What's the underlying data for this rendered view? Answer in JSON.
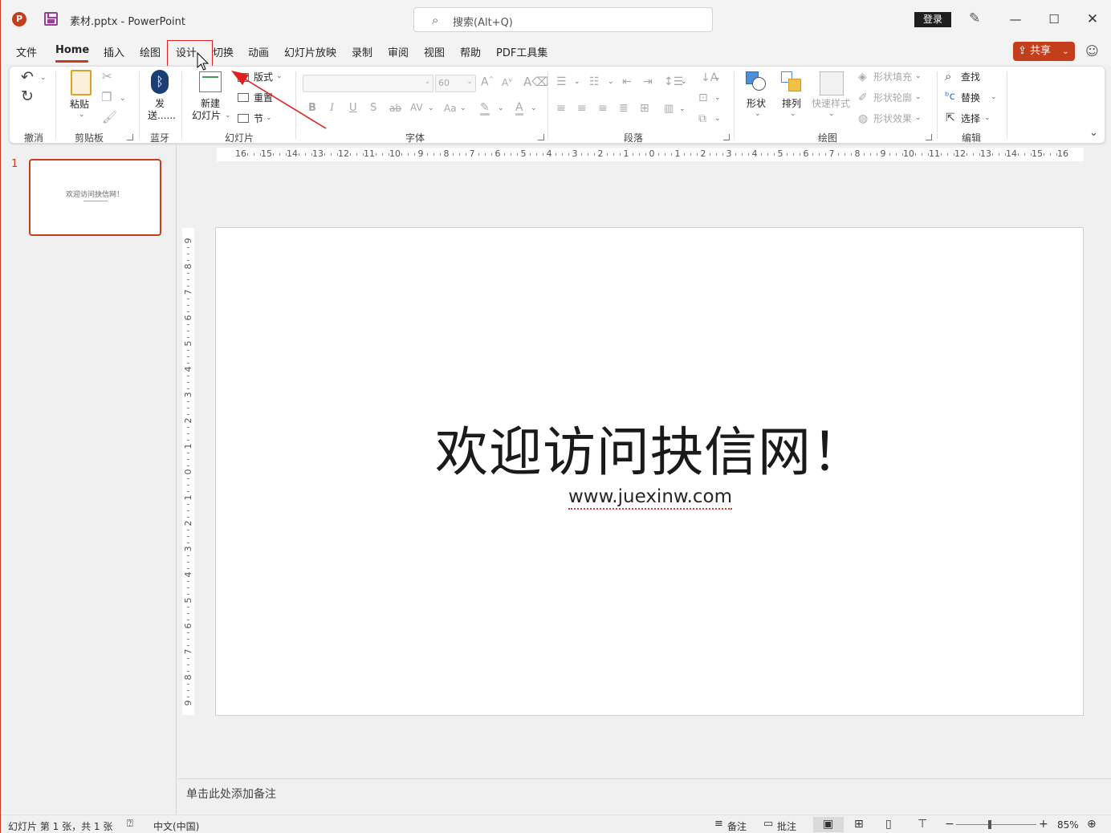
{
  "window": {
    "app_logo": "P",
    "title": "素材.pptx  -  PowerPoint",
    "search_placeholder": "搜索(Alt+Q)",
    "login_label": "登录",
    "minimize": "—",
    "maximize": "☐",
    "close": "✕"
  },
  "tabs": [
    {
      "label": "文件"
    },
    {
      "label": "Home"
    },
    {
      "label": "插入"
    },
    {
      "label": "绘图"
    },
    {
      "label": "设计"
    },
    {
      "label": "切换"
    },
    {
      "label": "动画"
    },
    {
      "label": "幻灯片放映"
    },
    {
      "label": "录制"
    },
    {
      "label": "审阅"
    },
    {
      "label": "视图"
    },
    {
      "label": "帮助"
    },
    {
      "label": "PDF工具集"
    }
  ],
  "share_label": "共享",
  "ribbon": {
    "groups": {
      "undo": "撤消",
      "clipboard": "剪贴板",
      "bluetooth": "蓝牙",
      "slides": "幻灯片",
      "font": "字体",
      "paragraph": "段落",
      "drawing": "绘图",
      "editing": "编辑"
    },
    "paste": "粘贴",
    "send_1": "发",
    "send_2": "送......",
    "new_slide_1": "新建",
    "new_slide_2": "幻灯片",
    "layout": "版式",
    "reset": "重置",
    "section": "节",
    "font_size": "60",
    "bold": "B",
    "italic": "I",
    "underline": "U",
    "shadow": "S",
    "strike": "ab",
    "spacing": "AV",
    "case": "Aa",
    "font_color": "A",
    "shapes": "形状",
    "arrange": "排列",
    "quick_styles": "快速样式",
    "shape_fill": "形状填充",
    "shape_outline": "形状轮廓",
    "shape_effects": "形状效果",
    "find": "查找",
    "replace": "替换",
    "select": "选择"
  },
  "slide_panel": {
    "number": "1",
    "thumb_title": "欢迎访问抉信网！"
  },
  "rulers": {
    "horizontal": [
      "16",
      "15",
      "14",
      "13",
      "12",
      "11",
      "10",
      "9",
      "8",
      "7",
      "6",
      "5",
      "4",
      "3",
      "2",
      "1",
      "0",
      "1",
      "2",
      "3",
      "4",
      "5",
      "6",
      "7",
      "8",
      "9",
      "10",
      "11",
      "12",
      "13",
      "14",
      "15",
      "16"
    ],
    "vertical": [
      "9",
      "8",
      "7",
      "6",
      "5",
      "4",
      "3",
      "2",
      "1",
      "0",
      "1",
      "2",
      "3",
      "4",
      "5",
      "6",
      "7",
      "8",
      "9"
    ]
  },
  "slide": {
    "title": "欢迎访问抉信网！",
    "subtitle": "www.juexinw.com"
  },
  "notes_placeholder": "单击此处添加备注",
  "status": {
    "slide_info": "幻灯片 第 1 张，共 1 张",
    "language": "中文(中国)",
    "notes": "备注",
    "comments": "批注",
    "zoom_minus": "−",
    "zoom_plus": "+",
    "zoom": "85%"
  },
  "colors": {
    "accent": "#c43e1c",
    "annotation_red": "#e02020"
  }
}
